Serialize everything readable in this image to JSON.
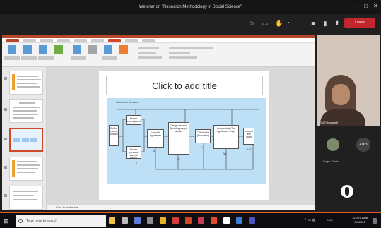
{
  "window": {
    "title": "Webinar on \"Research Methodology in Social Science\"",
    "minimize": "–",
    "maximize": "□",
    "close": "✕"
  },
  "toolbar": {
    "more": "···",
    "leave_label": "Leave"
  },
  "ppt": {
    "slide_title_placeholder": "Click to add title",
    "notes_placeholder": "Click to add notes",
    "diagram": {
      "review_label": "Review the literature",
      "boxes": [
        {
          "key": "define",
          "text": "Define research problem"
        },
        {
          "key": "review_concepts",
          "text": "Review concepts and theories"
        },
        {
          "key": "review_findings",
          "text": "Review previous research finding"
        },
        {
          "key": "hypothesis",
          "text": "Formulate hypotheses"
        },
        {
          "key": "design",
          "text": "Design research (including sample design)"
        },
        {
          "key": "collect",
          "text": "Collect data (Execution)"
        },
        {
          "key": "analyse",
          "text": "Analyse data (Test hypotheses if any)"
        },
        {
          "key": "interpret",
          "text": "Interpret and report"
        }
      ],
      "roman": [
        "I",
        "II",
        "III",
        "IV",
        "V",
        "VI",
        "VII"
      ]
    }
  },
  "participants": {
    "active_name": "SNITGuwahati",
    "second_name": "Sagar Gade...",
    "more_count": "+163"
  },
  "taskbar": {
    "search_placeholder": "Type here to search",
    "lang": "ENG",
    "time": "11:09:51 AM",
    "date": "9/8/2021"
  }
}
